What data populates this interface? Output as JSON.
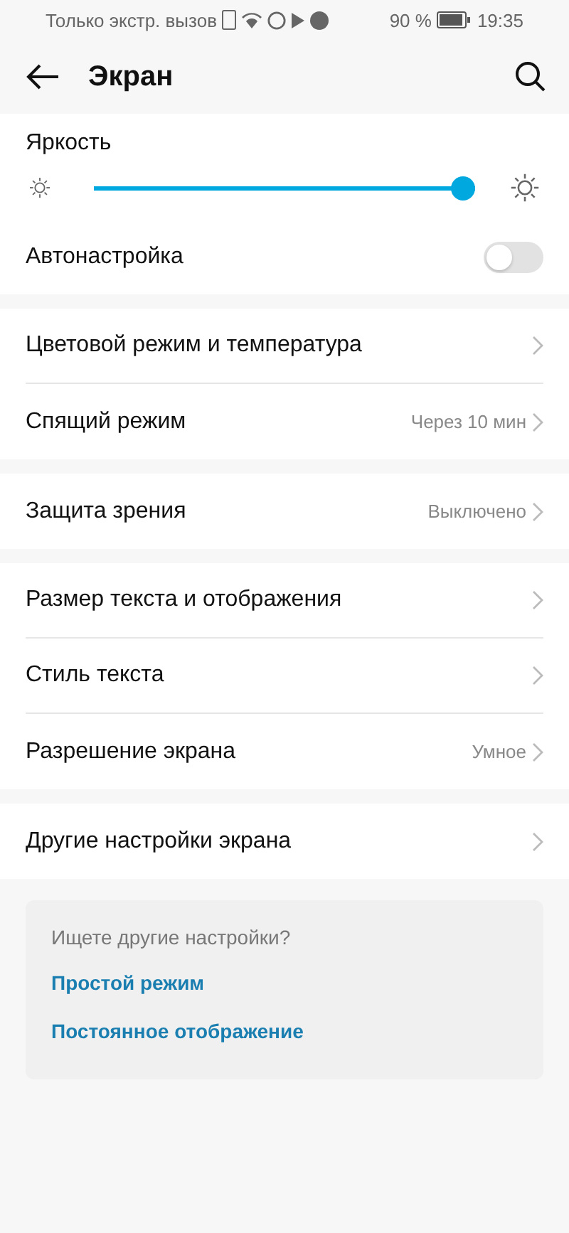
{
  "status_bar": {
    "carrier": "Только экстр. вызов",
    "battery": "90 %",
    "time": "19:35"
  },
  "header": {
    "title": "Экран"
  },
  "brightness": {
    "label": "Яркость",
    "level": 1.0
  },
  "auto": {
    "label": "Автонастройка",
    "on": false
  },
  "groups": [
    [
      {
        "label": "Цветовой режим и температура"
      },
      {
        "label": "Спящий режим",
        "value": "Через 10 мин"
      }
    ],
    [
      {
        "label": "Защита зрения",
        "value": "Выключено"
      }
    ],
    [
      {
        "label": "Размер текста и отображения"
      },
      {
        "label": "Стиль текста"
      },
      {
        "label": "Разрешение экрана",
        "value": "Умное"
      }
    ],
    [
      {
        "label": "Другие настройки экрана"
      }
    ]
  ],
  "suggest": {
    "title": "Ищете другие настройки?",
    "links": [
      "Простой режим",
      "Постоянное отображение"
    ]
  }
}
